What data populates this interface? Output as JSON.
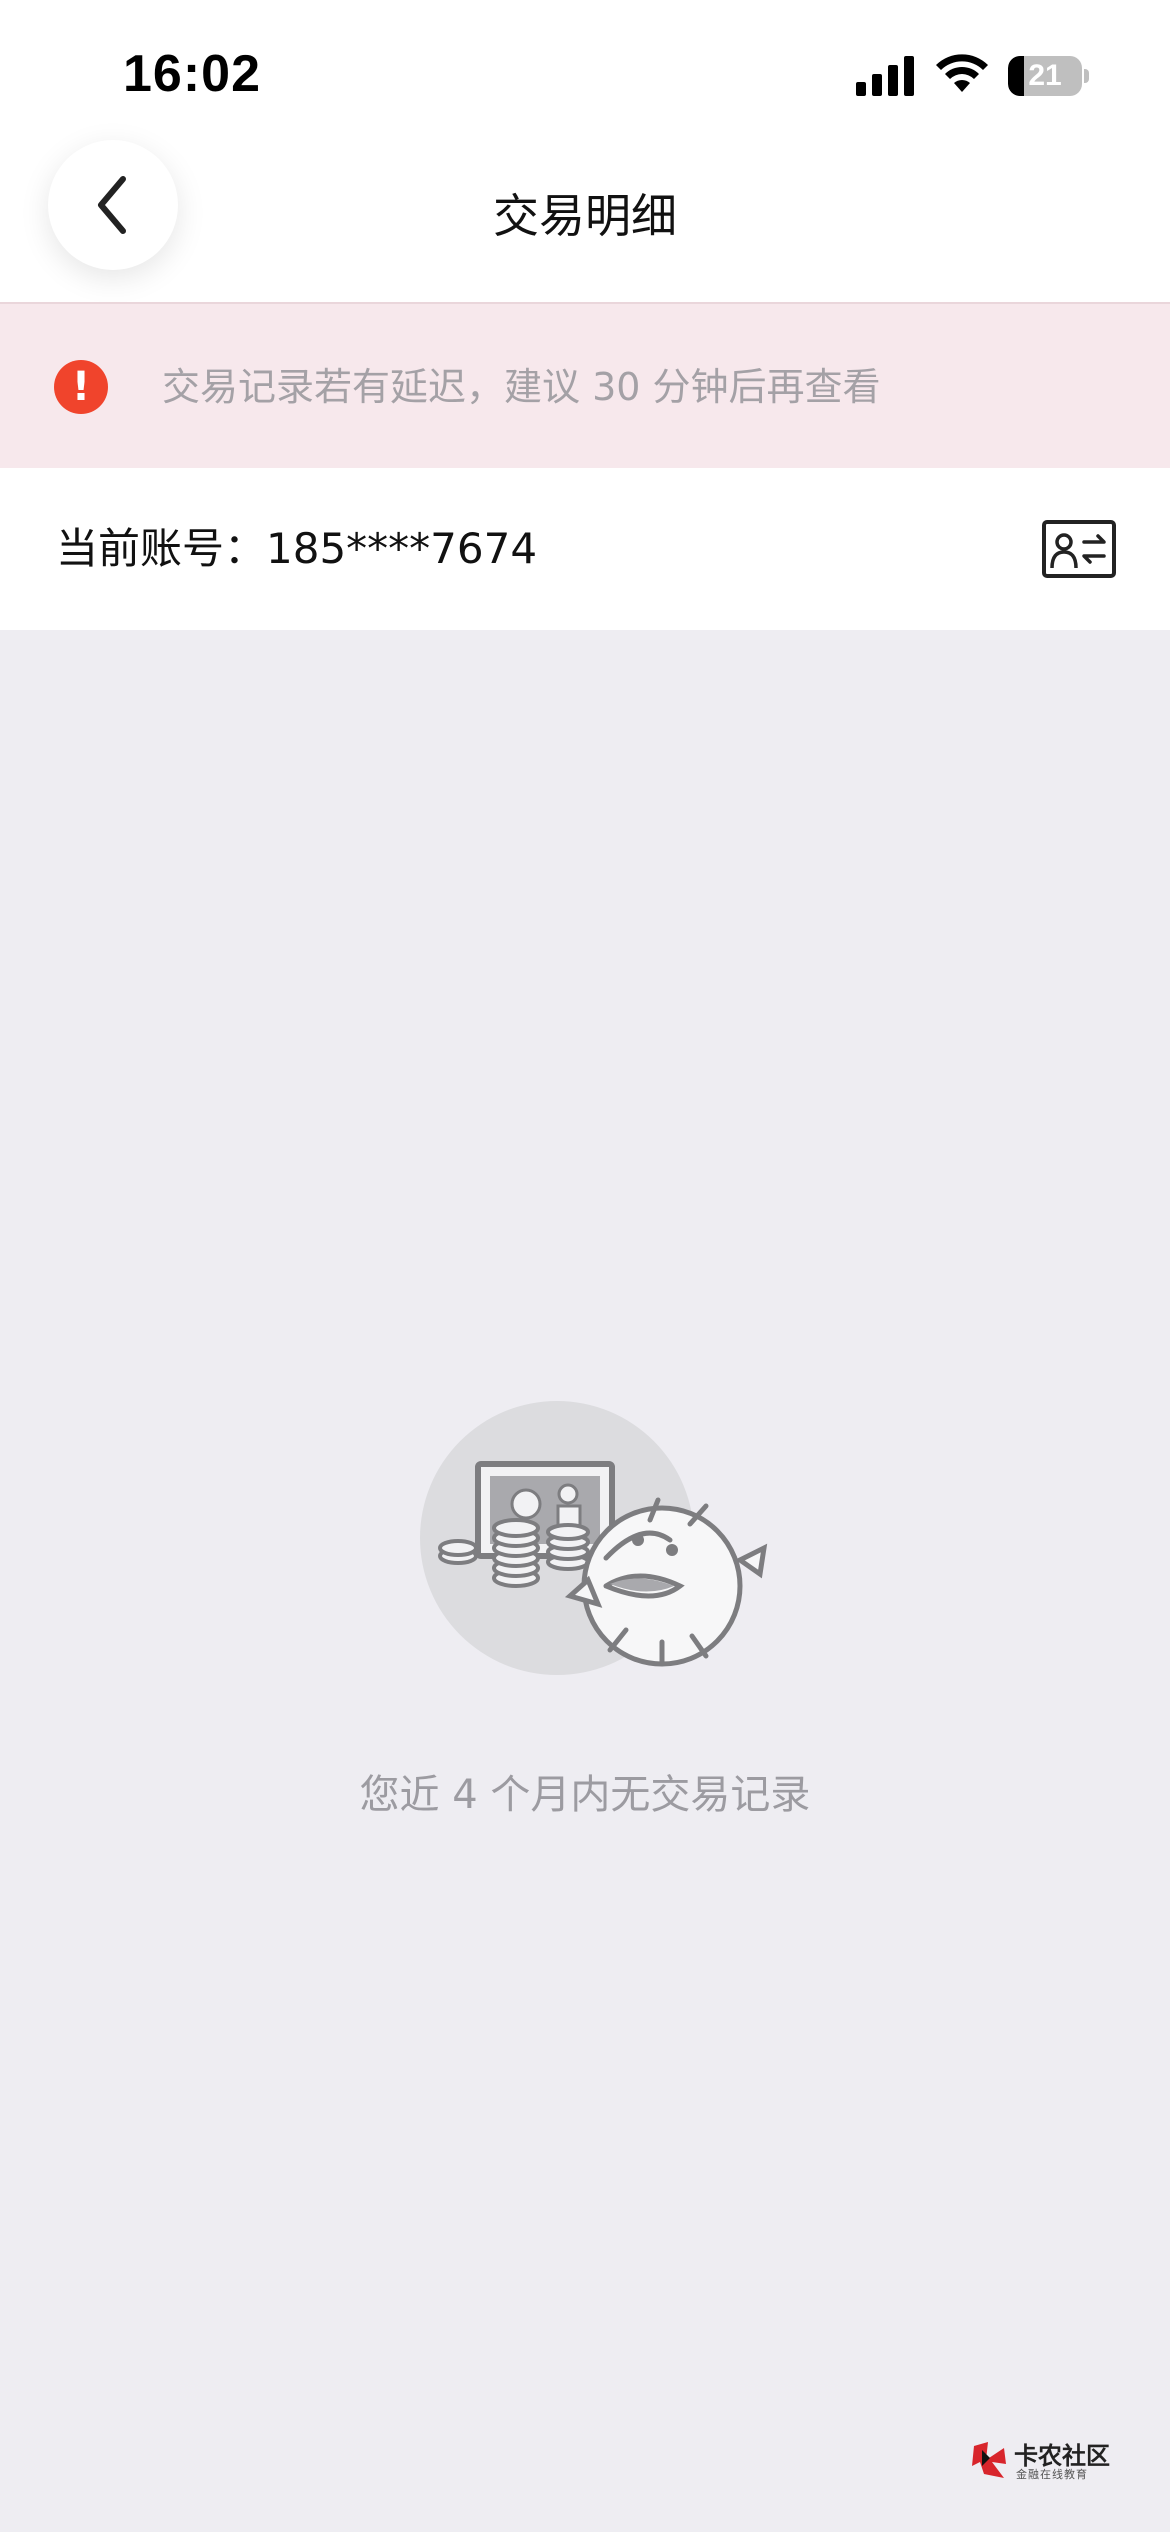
{
  "status_bar": {
    "time": "16:02",
    "battery_level": "21",
    "battery_fraction": 0.21,
    "icons": [
      "signal-icon",
      "wifi-icon",
      "battery-icon"
    ]
  },
  "nav": {
    "title": "交易明细",
    "back_icon": "chevron-left-icon"
  },
  "notice": {
    "icon": "alert-icon",
    "icon_glyph": "!",
    "text": "交易记录若有延迟，建议 30 分钟后再查看",
    "color": "#f0442c"
  },
  "account": {
    "label": "当前账号：185****7674",
    "switch_icon": "account-switch-icon"
  },
  "empty_state": {
    "illustration": "empty-transactions-illustration",
    "message": "您近 4 个月内无交易记录"
  },
  "watermark": {
    "title": "卡农社区",
    "subtitle": "金融在线教育"
  },
  "colors": {
    "background": "#eeedf2",
    "notice_bg": "#f7e8ec",
    "accent_red": "#f0442c",
    "text_muted": "#9c9ba1"
  }
}
